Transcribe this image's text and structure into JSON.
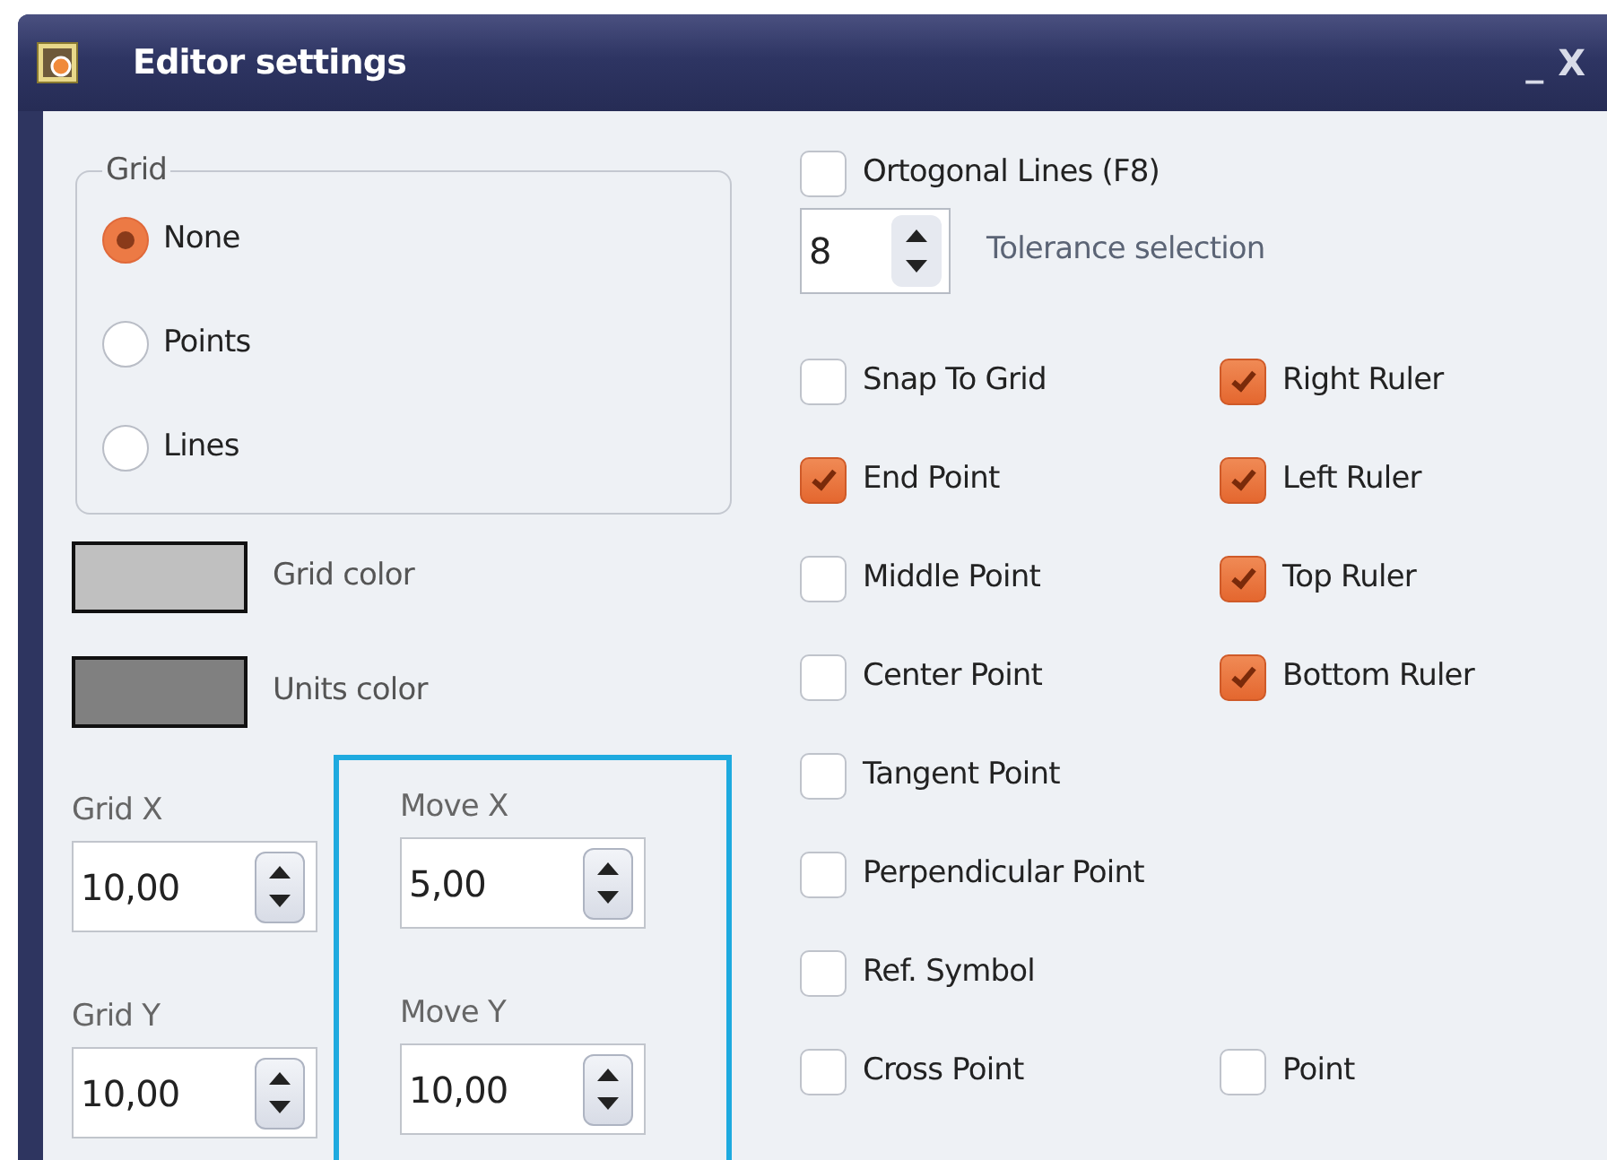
{
  "window": {
    "title": "Editor settings",
    "minimize": "_",
    "close": "X"
  },
  "grid": {
    "legend": "Grid",
    "options": [
      {
        "label": "None",
        "selected": true
      },
      {
        "label": "Points",
        "selected": false
      },
      {
        "label": "Lines",
        "selected": false
      }
    ]
  },
  "colors": [
    {
      "label": "Grid color",
      "color": "#c0c0c0"
    },
    {
      "label": "Units color",
      "color": "#808080"
    }
  ],
  "grid_steps": [
    {
      "label": "Grid X",
      "value": "10,00"
    },
    {
      "label": "Grid Y",
      "value": "10,00"
    }
  ],
  "move_steps": [
    {
      "label": "Move X",
      "value": "5,00"
    },
    {
      "label": "Move Y",
      "value": "10,00"
    }
  ],
  "orthogonal": {
    "label": "Ortogonal Lines (F8)",
    "checked": false
  },
  "tolerance": {
    "value": "8",
    "label": "Tolerance selection"
  },
  "option_rows": [
    [
      {
        "label": "Snap To Grid",
        "checked": false
      },
      {
        "label": "Right Ruler",
        "checked": true
      }
    ],
    [
      {
        "label": "End Point",
        "checked": true
      },
      {
        "label": "Left Ruler",
        "checked": true
      }
    ],
    [
      {
        "label": "Middle Point",
        "checked": false
      },
      {
        "label": "Top Ruler",
        "checked": true
      }
    ],
    [
      {
        "label": "Center Point",
        "checked": false
      },
      {
        "label": "Bottom Ruler",
        "checked": true
      }
    ],
    [
      {
        "label": "Tangent Point",
        "checked": false
      }
    ],
    [
      {
        "label": "Perpendicular Point",
        "checked": false
      }
    ],
    [
      {
        "label": "Ref. Symbol",
        "checked": false
      }
    ],
    [
      {
        "label": "Cross Point",
        "checked": false
      },
      {
        "label": "Point",
        "checked": false
      }
    ]
  ]
}
